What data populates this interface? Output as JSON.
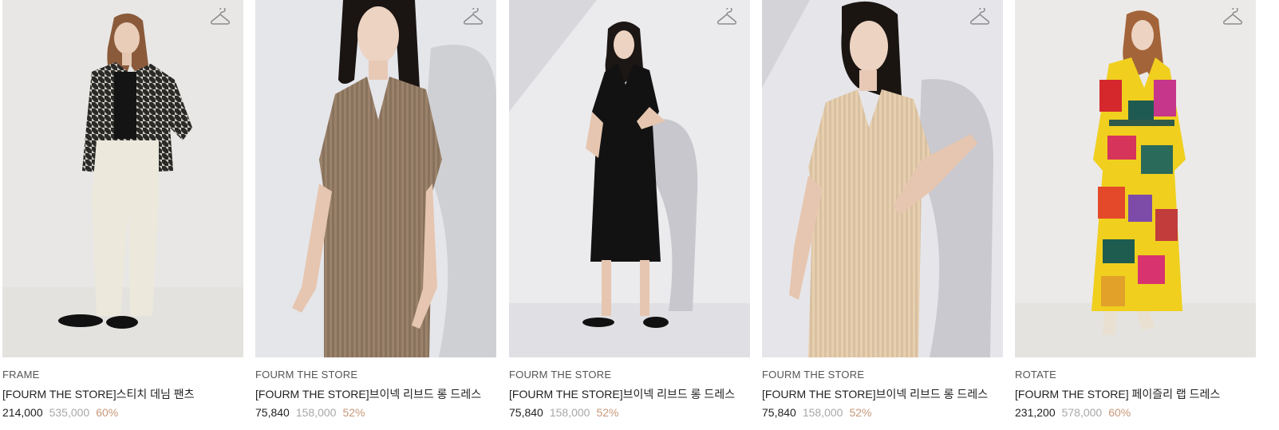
{
  "products": [
    {
      "brand": "FRAME",
      "title": "[FOURM THE STORE]스티치 데님 팬츠",
      "price": "214,000",
      "original_price": "535,000",
      "discount": "60%",
      "wishlist_icon": "hanger-icon"
    },
    {
      "brand": "FOURM THE STORE",
      "title": "[FOURM THE STORE]브이넥 리브드 롱 드레스",
      "price": "75,840",
      "original_price": "158,000",
      "discount": "52%",
      "wishlist_icon": "hanger-icon"
    },
    {
      "brand": "FOURM THE STORE",
      "title": "[FOURM THE STORE]브이넥 리브드 롱 드레스",
      "price": "75,840",
      "original_price": "158,000",
      "discount": "52%",
      "wishlist_icon": "hanger-icon"
    },
    {
      "brand": "FOURM THE STORE",
      "title": "[FOURM THE STORE]브이넥 리브드 롱 드레스",
      "price": "75,840",
      "original_price": "158,000",
      "discount": "52%",
      "wishlist_icon": "hanger-icon"
    },
    {
      "brand": "ROTATE",
      "title": "[FOURM THE STORE] 페이즐리 랩 드레스",
      "price": "231,200",
      "original_price": "578,000",
      "discount": "60%",
      "wishlist_icon": "hanger-icon"
    }
  ],
  "colors": {
    "discount": "#c8987a",
    "original_price": "#a8a8a8",
    "text": "#222222"
  }
}
